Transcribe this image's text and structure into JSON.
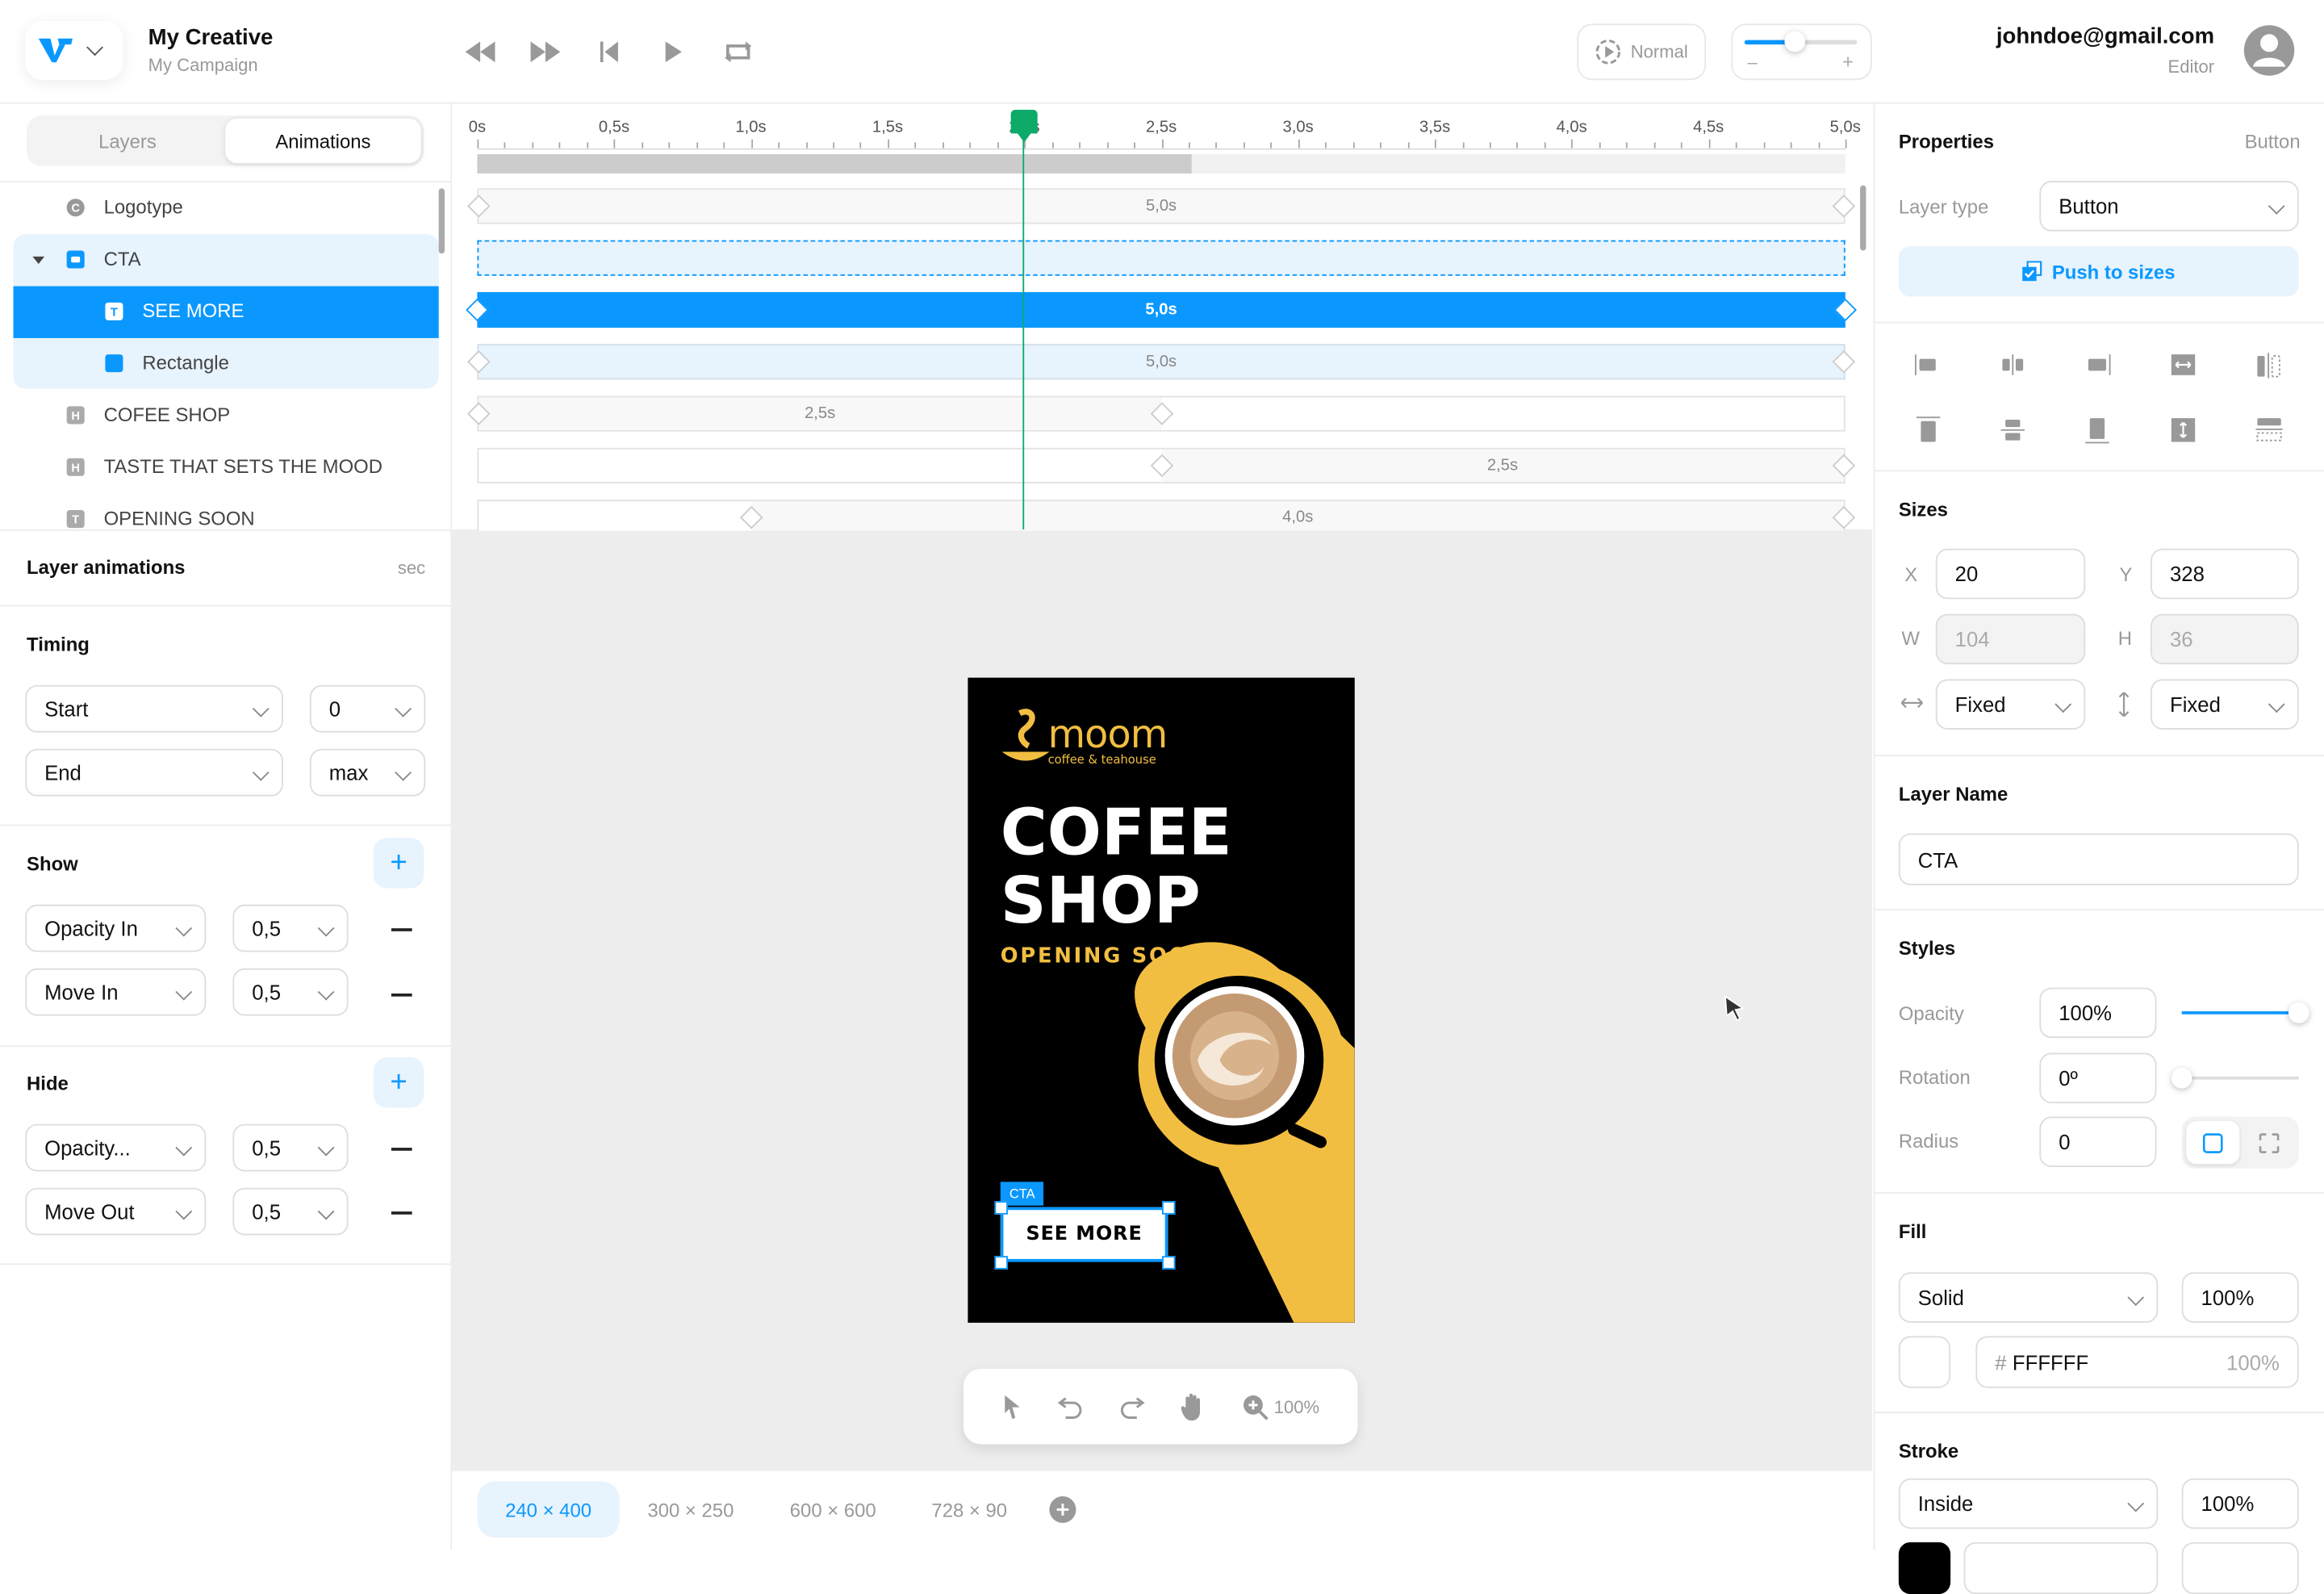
{
  "app": {
    "title": "My Creative",
    "subtitle": "My Campaign",
    "brand_color": "#0A98FF"
  },
  "playback": {
    "controls": [
      "rewind",
      "fast-forward",
      "skip-to-start",
      "play",
      "loop"
    ],
    "speed_label": "Normal",
    "zoom_slider_fraction": 0.45,
    "zoom_minus": "–",
    "zoom_plus": "+"
  },
  "user": {
    "email": "johndoe@gmail.com",
    "role": "Editor"
  },
  "left_tabs": [
    {
      "label": "Layers",
      "active": false
    },
    {
      "label": "Animations",
      "active": true
    }
  ],
  "layers": [
    {
      "label": "Logotype",
      "icon": "C",
      "indent": 0,
      "state": "normal"
    },
    {
      "label": "CTA",
      "icon": "button",
      "indent": 0,
      "state": "group-selected",
      "expanded": true
    },
    {
      "label": "SEE MORE",
      "icon": "T",
      "indent": 1,
      "state": "selected"
    },
    {
      "label": "Rectangle",
      "icon": "rect",
      "indent": 1,
      "state": "group-selected"
    },
    {
      "label": "COFEE SHOP",
      "icon": "H",
      "indent": 0,
      "state": "normal"
    },
    {
      "label": "TASTE THAT SETS THE MOOD",
      "icon": "H",
      "indent": 0,
      "state": "normal"
    },
    {
      "label": "OPENING SOON",
      "icon": "T",
      "indent": 0,
      "state": "normal"
    }
  ],
  "layer_animations": {
    "title": "Layer animations",
    "unit": "sec",
    "timing": {
      "title": "Timing",
      "rows": [
        {
          "type": "Start",
          "value": "0"
        },
        {
          "type": "End",
          "value": "max"
        }
      ]
    },
    "show": {
      "title": "Show",
      "add_label": "+",
      "rows": [
        {
          "effect": "Opacity In",
          "duration": "0,5"
        },
        {
          "effect": "Move In",
          "duration": "0,5"
        }
      ]
    },
    "hide": {
      "title": "Hide",
      "add_label": "+",
      "rows": [
        {
          "effect": "Opacity...",
          "duration": "0,5"
        },
        {
          "effect": "Move Out",
          "duration": "0,5"
        }
      ]
    }
  },
  "timeline": {
    "ticks": [
      "0s",
      "0,5s",
      "1,0s",
      "1,5s",
      "2,0s",
      "2,5s",
      "3,0s",
      "3,5s",
      "4,0s",
      "4,5s",
      "5,0s"
    ],
    "total_seconds": 5.0,
    "playhead_seconds": 2.0,
    "progress_seconds": 2.61,
    "playhead_color": "#0DAA6A",
    "tracks": [
      {
        "layer": "Logotype",
        "start": 0,
        "end": 5.0,
        "label": "5,0s",
        "style": "normal"
      },
      {
        "layer": "CTA",
        "start": 0,
        "end": 5.0,
        "label": "",
        "style": "group"
      },
      {
        "layer": "SEE MORE",
        "start": 0,
        "end": 5.0,
        "label": "5,0s",
        "style": "selected"
      },
      {
        "layer": "Rectangle",
        "start": 0,
        "end": 5.0,
        "label": "5,0s",
        "style": "child"
      },
      {
        "layer": "COFEE SHOP",
        "start": 0,
        "end": 2.5,
        "label": "2,5s",
        "style": "normal"
      },
      {
        "layer": "TASTE THAT SETS THE MOOD",
        "start": 2.5,
        "end": 5.0,
        "label": "2,5s",
        "style": "normal"
      },
      {
        "layer": "OPENING SOON",
        "start": 1.0,
        "end": 5.0,
        "label": "4,0s",
        "style": "normal"
      }
    ]
  },
  "banner": {
    "brand": "moom",
    "brand_tagline": "coffee & teahouse",
    "headline_line1": "COFEE",
    "headline_line2": "SHOP",
    "subline": "OPENING SOON",
    "cta_tag": "CTA",
    "cta_label": "SEE MORE",
    "accent_color": "#F2BE41"
  },
  "canvas_tools": {
    "items": [
      "select",
      "undo",
      "redo",
      "pan",
      "zoom"
    ],
    "zoom_label": "100%"
  },
  "sizes": [
    {
      "label": "240 × 400",
      "active": true
    },
    {
      "label": "300 × 250",
      "active": false
    },
    {
      "label": "600 × 600",
      "active": false
    },
    {
      "label": "728 × 90",
      "active": false
    }
  ],
  "properties": {
    "title": "Properties",
    "type_hint": "Button",
    "layer_type_label": "Layer type",
    "layer_type_value": "Button",
    "push_label": "Push to sizes",
    "align_tools": [
      "align-left",
      "align-center-h",
      "align-right",
      "stretch-horizontal",
      "distribute-horizontal",
      "align-top",
      "align-center-v",
      "align-bottom",
      "stretch-vertical",
      "distribute-vertical"
    ],
    "sizes": {
      "title": "Sizes",
      "x_label": "X",
      "x": "20",
      "y_label": "Y",
      "y": "328",
      "w_label": "W",
      "w": "104",
      "h_label": "H",
      "h": "36",
      "h_mode": "Fixed",
      "v_mode": "Fixed"
    },
    "layer_name": {
      "title": "Layer Name",
      "value": "CTA"
    },
    "styles": {
      "title": "Styles",
      "opacity_label": "Opacity",
      "opacity": "100%",
      "opacity_fraction": 1.0,
      "rotation_label": "Rotation",
      "rotation": "0º",
      "rotation_fraction": 0.0,
      "radius_label": "Radius",
      "radius": "0"
    },
    "fill": {
      "title": "Fill",
      "type": "Solid",
      "opacity": "100%",
      "hash": "#",
      "hex": "FFFFFF",
      "hex_opacity": "100%",
      "swatch_color": "#FFFFFF"
    },
    "stroke": {
      "title": "Stroke",
      "position": "Inside",
      "opacity": "100%",
      "swatch_color": "#000000"
    }
  }
}
